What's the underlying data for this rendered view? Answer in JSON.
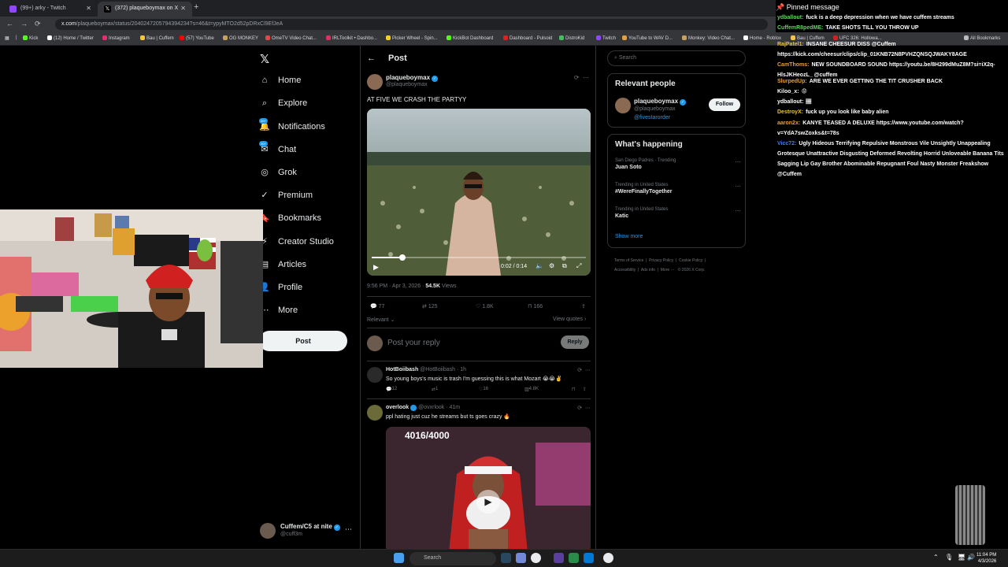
{
  "browser": {
    "tabs": [
      {
        "title": "(99+) arky - Twitch",
        "active": false,
        "color": "#9146ff"
      },
      {
        "title": "(372) plaqueboymax on X",
        "active": true,
        "color": "#ffffff"
      }
    ],
    "new_tab_icon": "plus-icon",
    "url_host": "x.com",
    "url_path": "/plaqueboymax/status/2040247205794394234?s=46&t=ypyMTO2d52pDRxCl9EfJeA",
    "bookmarks": [
      {
        "label": "Kick",
        "color": "#53fc18"
      },
      {
        "label": "(12) Home / Twitter",
        "color": "#ffffff"
      },
      {
        "label": "Instagram",
        "color": "#e1306c"
      },
      {
        "label": "Bau | Cuffem",
        "color": "#f5c542"
      },
      {
        "label": "(57) YouTube",
        "color": "#ff0000"
      },
      {
        "label": "OG MONKEY",
        "color": "#c8a060"
      },
      {
        "label": "OmeTV Video Chat...",
        "color": "#e04848"
      },
      {
        "label": "IRLToolkit • Dashbo...",
        "color": "#e03060"
      },
      {
        "label": "Picker Wheel - Spin...",
        "color": "#f5d020"
      },
      {
        "label": "KickBot Dashboard",
        "color": "#53fc18"
      },
      {
        "label": "Dashboard - Pulsoid",
        "color": "#e02020"
      },
      {
        "label": "DistroKid",
        "color": "#40c060"
      },
      {
        "label": "Twitch",
        "color": "#9146ff"
      },
      {
        "label": "YouTube to WAV D...",
        "color": "#e0a040"
      },
      {
        "label": "Monkey: Video Chat...",
        "color": "#c8a060"
      },
      {
        "label": "Home - Roblox",
        "color": "#ffffff"
      },
      {
        "label": "Bau | Cuffem",
        "color": "#f5c542"
      },
      {
        "label": "UFC 326: Hollowa...",
        "color": "#d02020"
      }
    ],
    "all_bookmarks": "All Bookmarks"
  },
  "nav": {
    "items": [
      {
        "label": "Home",
        "icon": "home-icon",
        "glyph": "⌂"
      },
      {
        "label": "Explore",
        "icon": "search-icon",
        "glyph": "⌕"
      },
      {
        "label": "Notifications",
        "icon": "bell-icon",
        "glyph": "🔔",
        "badge": "20+"
      },
      {
        "label": "Chat",
        "icon": "chat-icon",
        "glyph": "✉",
        "badge": "20+"
      },
      {
        "label": "Grok",
        "icon": "grok-icon",
        "glyph": "◎"
      },
      {
        "label": "Premium",
        "icon": "x-premium-icon",
        "glyph": "✓"
      },
      {
        "label": "Bookmarks",
        "icon": "bookmark-icon",
        "glyph": "🔖"
      },
      {
        "label": "Creator Studio",
        "icon": "creator-studio-icon",
        "glyph": "⚡"
      },
      {
        "label": "Articles",
        "icon": "articles-icon",
        "glyph": "▤"
      },
      {
        "label": "Profile",
        "icon": "profile-icon",
        "glyph": "👤"
      },
      {
        "label": "More",
        "icon": "more-icon",
        "glyph": "⋯"
      }
    ],
    "post_label": "Post",
    "account": {
      "name": "Cuffem/C5 at nite",
      "handle": "@cuff3m"
    }
  },
  "post": {
    "header": "Post",
    "author_name": "plaqueboymax",
    "author_handle": "@plaqueboymax",
    "text": "AT FIVE WE CRASH THE PARTYY",
    "video": {
      "time": "0:02 / 0:14",
      "progress": 0.143
    },
    "timestamp": "9:56 PM · Apr 3, 2026 · ",
    "views_count": "54.5K",
    "views_label": " Views",
    "stats": {
      "replies": "77",
      "reposts": "125",
      "likes": "1.8K",
      "bookmarks": "166"
    },
    "relevant": "Relevant",
    "view_quotes": "View quotes",
    "reply_placeholder": "Post your reply",
    "reply_button": "Reply"
  },
  "replies": [
    {
      "name": "HotBoiibash",
      "meta": " @HotBoiibash · 1h",
      "text": "So young boys's music is trash I'm guessing this is what Mozart 😭😭✌️",
      "stats": {
        "replies": "12",
        "reposts": "1",
        "likes": "16",
        "views": "4.8K"
      },
      "avatar_color": "#2a2a2a"
    },
    {
      "name": "overlook",
      "meta": " @ovxrlook · 41m",
      "text": "ppl hating just cuz he streams but ts goes crazy 🔥",
      "gif_caption": "4016/4000",
      "avatar_color": "#6b6b3a"
    }
  ],
  "sidebar": {
    "search_placeholder": "Search",
    "relevant_people_title": "Relevant people",
    "person": {
      "name": "plaqueboymax",
      "handle": "@plaqueboymax",
      "bio": "@fivestarorder",
      "follow": "Follow"
    },
    "whats_happening_title": "What's happening",
    "trends": [
      {
        "context": "San Diego Padres · Trending",
        "name": "Juan Soto"
      },
      {
        "context": "Trending in United States",
        "name": "#WereFinallyTogether"
      },
      {
        "context": "Trending in United States",
        "name": "Katic"
      }
    ],
    "show_more": "Show more",
    "footer": [
      "Terms of Service",
      "Privacy Policy",
      "Cookie Policy",
      "Accessibility",
      "Ads info",
      "More ···",
      "© 2026 X Corp."
    ]
  },
  "chat": {
    "pinned": "Pinned message",
    "messages": [
      {
        "user": "ydballout:",
        "color": "#5fd35f",
        "text": "fuck is a deep depression when we have cuffem streams"
      },
      {
        "user": "CuffemR8pedME:",
        "color": "#5fd35f",
        "text": "TAKE SHOTS TILL YOU THROW UP"
      },
      {
        "user": "RajPatel1:",
        "color": "#e8c33a",
        "text": "INSANE CHEESUR DISS @Cuffem https://kick.com/cheesur/clips/clip_01KNB72N8PVHZQNSQJWAKY8AGE"
      },
      {
        "user": "CamThoms:",
        "color": "#e8a03a",
        "text": "NEW SOUNDBOARD SOUND https://youtu.be/8H299dMuZ8M?si=iX2q-HlsJKHeozL_ @cuffem"
      },
      {
        "user": "SlurpedUp:",
        "color": "#e8a03a",
        "text": "ARE WE EVER GETTING THE TIT CRUSHER BACK"
      },
      {
        "user": "Kiloo_x:",
        "color": "#ffffff",
        "text": "😡"
      },
      {
        "user": "ydballout:",
        "color": "#ffffff",
        "text": "🏽"
      },
      {
        "user": "DestroyX:",
        "color": "#e8c33a",
        "text": "fuck up you look like baby alien"
      },
      {
        "user": "aaron2x:",
        "color": "#e8a03a",
        "text": "KANYE TEASED A DELUXE https://www.youtube.com/watch?v=YdA7swZoxks&t=78s"
      },
      {
        "user": "Vicc72:",
        "color": "#4a7adf",
        "text": "Ugly Hideous Terrifying Repulsive Monstrous Vile Unsightly Unappealing Grotesque Unattractive Disgusting Deformed Revolting Horrid Unloveable Banana Tits Sagging Lip Gay Brother Abominable Repugnant Foul Nasty Monster Freakshow @Cuffem"
      }
    ]
  },
  "taskbar": {
    "search": "Search",
    "time": "11:04 PM",
    "date": "4/3/2026"
  }
}
